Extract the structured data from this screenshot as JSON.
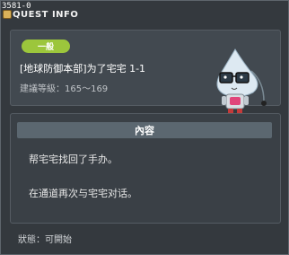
{
  "window": {
    "quest_id": "3581-0",
    "title": "QUEST INFO",
    "title_icon": "quest-book-icon"
  },
  "quest": {
    "difficulty": "一般",
    "name": "[地球防御本部]为了宅宅 1-1",
    "level_requirement": "建議等級：165～169",
    "npc_image": "robot-npc-with-glasses"
  },
  "content": {
    "header": "內容",
    "lines": [
      "帮宅宅找回了手办。",
      "在通道再次与宅宅对话。"
    ]
  },
  "status": {
    "text": "狀態：可開始"
  },
  "colors": {
    "badge": "#9cc63c",
    "background": "#34393e",
    "panel": "#424950",
    "header_bar": "#5b6770"
  }
}
